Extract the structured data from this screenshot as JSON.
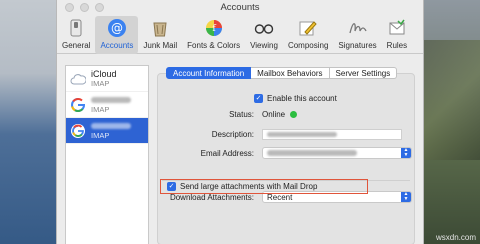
{
  "window": {
    "title": "Accounts"
  },
  "toolbar": {
    "items": [
      {
        "label": "General",
        "icon": "switch-icon"
      },
      {
        "label": "Accounts",
        "icon": "at-sign-icon"
      },
      {
        "label": "Junk Mail",
        "icon": "junk-bin-icon"
      },
      {
        "label": "Fonts & Colors",
        "icon": "color-wheel-icon"
      },
      {
        "label": "Viewing",
        "icon": "glasses-icon"
      },
      {
        "label": "Composing",
        "icon": "pencil-icon"
      },
      {
        "label": "Signatures",
        "icon": "signature-icon"
      },
      {
        "label": "Rules",
        "icon": "envelope-rules-icon"
      }
    ]
  },
  "accounts": [
    {
      "name": "iCloud",
      "type": "IMAP",
      "icon": "cloud-icon"
    },
    {
      "name": "",
      "type": "IMAP",
      "icon": "google-icon"
    },
    {
      "name": "",
      "type": "IMAP",
      "icon": "google-icon",
      "selected": true
    }
  ],
  "tabs": [
    "Account Information",
    "Mailbox Behaviors",
    "Server Settings"
  ],
  "form": {
    "enable_label": "Enable this account",
    "status_label": "Status:",
    "status_value": "Online",
    "description_label": "Description:",
    "email_label": "Email Address:",
    "download_label": "Download Attachments:",
    "download_value": "Recent",
    "maildrop_label": "Send large attachments with Mail Drop"
  },
  "colors": {
    "accent": "#2d6be4",
    "online": "#2bbe3f",
    "highlight": "#e0553b"
  },
  "watermark": "wsxdn.com"
}
